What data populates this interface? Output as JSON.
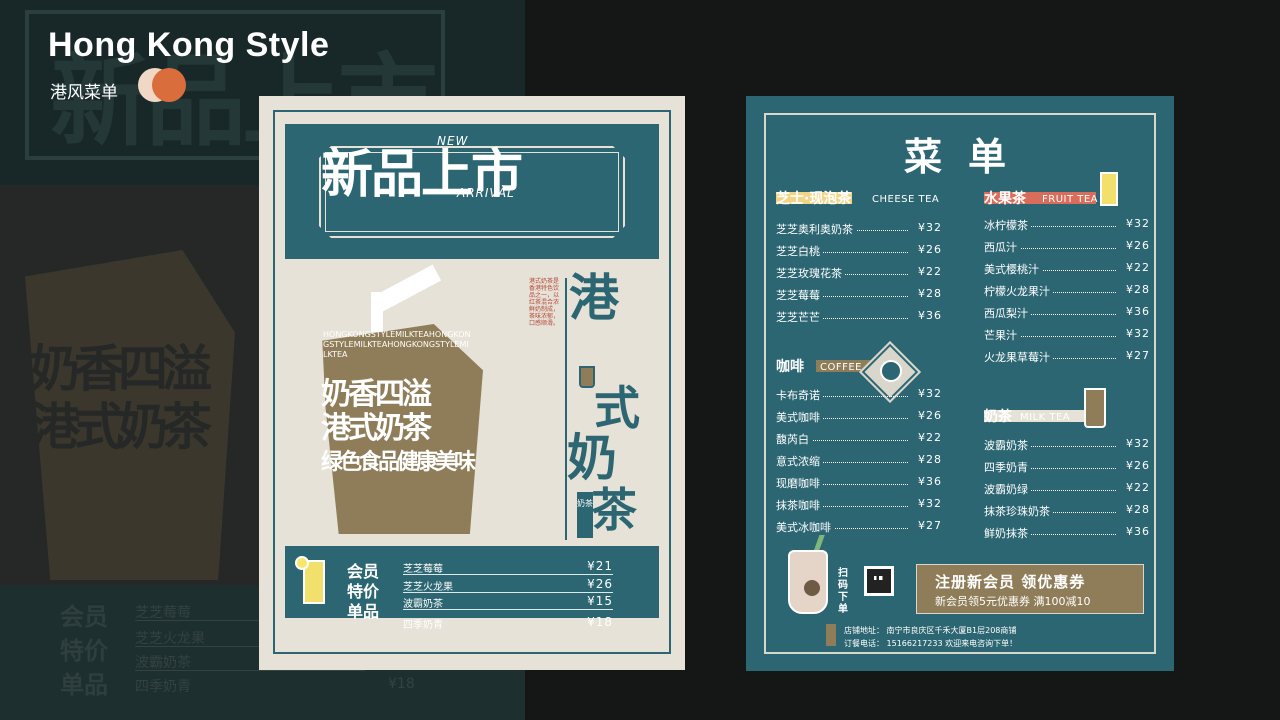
{
  "header": {
    "title_en": "Hong Kong Style",
    "title_cn": "港风菜单"
  },
  "colors": {
    "teal": "#2c6672",
    "cream": "#e7e2d7",
    "khaki": "#8e7d58",
    "accent_orange": "#d96d3c",
    "accent_peach": "#f1d8c6"
  },
  "background_echo": {
    "member_label": [
      "会员",
      "特价",
      "单品"
    ],
    "items": [
      "芝芝莓莓",
      "芝芝火龙果",
      "波霸奶茶",
      "四季奶青"
    ],
    "price": "¥18"
  },
  "poster1": {
    "headline": "新品上市",
    "new": "NEW",
    "arrival": "ARRIVAL",
    "cup_text": [
      "奶香四溢",
      "港式奶茶",
      "绿色食品健康美味"
    ],
    "cup_small_text": "HONGKONGSTYLEMILKTEAHONGKONGSTYLEMILKTEAHONGKONGSTYLEMILKTEA",
    "side_title": [
      "港",
      "式",
      "奶",
      "茶"
    ],
    "side_tag": "奶茶",
    "red_text": "港式奶茶是香港特色饮品之一，以红茶混合浓鲜奶制成，茶味浓郁，口感顺滑。",
    "member_label": [
      "会员",
      "特价",
      "单品"
    ],
    "specials": [
      {
        "name": "芝芝莓莓",
        "price": "¥21"
      },
      {
        "name": "芝芝火龙果",
        "price": "¥26"
      },
      {
        "name": "波霸奶茶",
        "price": "¥15"
      },
      {
        "name": "四季奶青",
        "price": "¥18"
      }
    ]
  },
  "poster2": {
    "title": "菜单",
    "sections": {
      "cheese": {
        "cn": "芝士·现泡茶",
        "en": "CHEESE TEA",
        "items": [
          {
            "name": "芝芝奥利奥奶茶",
            "price": "¥32"
          },
          {
            "name": "芝芝白桃",
            "price": "¥26"
          },
          {
            "name": "芝芝玫瑰花茶",
            "price": "¥22"
          },
          {
            "name": "芝芝莓莓",
            "price": "¥28"
          },
          {
            "name": "芝芝芒芒",
            "price": "¥36"
          }
        ]
      },
      "fruit": {
        "cn": "水果茶",
        "en": "FRUIT TEA",
        "items": [
          {
            "name": "冰柠檬茶",
            "price": "¥32"
          },
          {
            "name": "西瓜汁",
            "price": "¥26"
          },
          {
            "name": "美式樱桃汁",
            "price": "¥22"
          },
          {
            "name": "柠檬火龙果汁",
            "price": "¥28"
          },
          {
            "name": "西瓜梨汁",
            "price": "¥36"
          },
          {
            "name": "芒果汁",
            "price": "¥32"
          },
          {
            "name": "火龙果草莓汁",
            "price": "¥27"
          }
        ]
      },
      "coffee": {
        "cn": "咖啡",
        "en": "COFFEE",
        "items": [
          {
            "name": "卡布奇诺",
            "price": "¥32"
          },
          {
            "name": "美式咖啡",
            "price": "¥26"
          },
          {
            "name": "馥芮白",
            "price": "¥22"
          },
          {
            "name": "意式浓缩",
            "price": "¥28"
          },
          {
            "name": "现磨咖啡",
            "price": "¥36"
          },
          {
            "name": "抹茶咖啡",
            "price": "¥32"
          },
          {
            "name": "美式冰咖啡",
            "price": "¥27"
          }
        ]
      },
      "milk": {
        "cn": "奶茶",
        "en": "MILK TEA",
        "items": [
          {
            "name": "波霸奶茶",
            "price": "¥32"
          },
          {
            "name": "四季奶青",
            "price": "¥26"
          },
          {
            "name": "波霸奶绿",
            "price": "¥22"
          },
          {
            "name": "抹茶珍珠奶茶",
            "price": "¥28"
          },
          {
            "name": "鲜奶抹茶",
            "price": "¥36"
          }
        ]
      }
    },
    "scan": "扫码下单",
    "promo_main": "注册新会员    领优惠券",
    "promo_sub": "新会员领5元优惠券   满100减10",
    "address": "店铺地址：  南宁市良庆区千禾大厦B1层208商铺",
    "phone": "订餐电话：  15166217233   欢迎来电咨询下单！"
  }
}
